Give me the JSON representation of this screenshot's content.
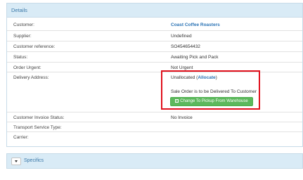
{
  "details": {
    "title": "Details",
    "customer": {
      "label": "Customer:",
      "value": "Coast Coffee Roasters"
    },
    "supplier": {
      "label": "Supplier:",
      "value": "Undefined"
    },
    "customer_reference": {
      "label": "Customer reference:",
      "value": "SO454654432"
    },
    "status": {
      "label": "Status:",
      "value": "Awaiting Pick and Pack"
    },
    "order_urgent": {
      "label": "Order Urgent:",
      "value": "Not Urgent"
    },
    "delivery_address": {
      "label": "Delivery Address:",
      "value_prefix": "Unallocated (",
      "allocate_link": "Allocate",
      "value_suffix": ")",
      "note": "Sale Order is to be Delivered To Customer",
      "button_label": "Change To Pickup From Warehouse"
    },
    "invoice_status": {
      "label": "Customer Invoice Status:",
      "value": "No Invoice"
    },
    "transport_service_type": {
      "label": "Transport Service Type:",
      "value": ""
    },
    "carrier": {
      "label": "Carrier:",
      "value": ""
    }
  },
  "specifics": {
    "title": "Specifics"
  },
  "colors": {
    "accent": "#3a78a8",
    "header_bg": "#d9ebf6",
    "highlight": "#e0101c",
    "button": "#5cb85c"
  }
}
